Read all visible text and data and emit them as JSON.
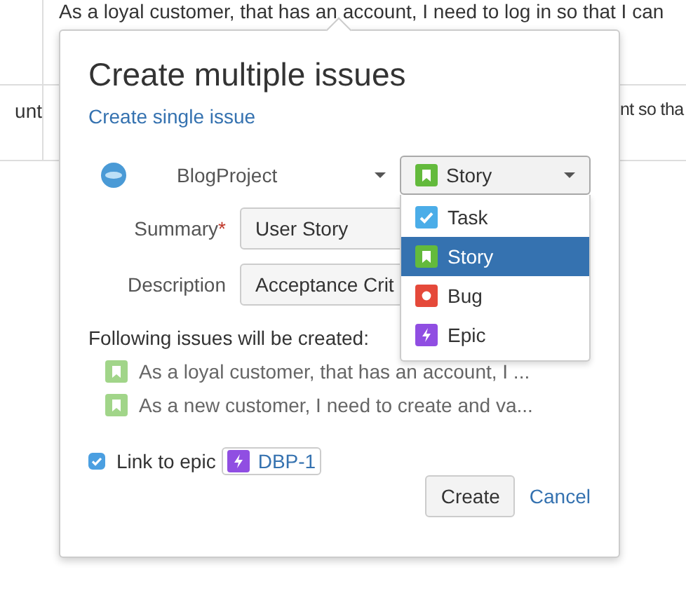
{
  "background": {
    "top_text": "As a loyal customer, that has an account, I need to log in so that I can",
    "left_text": "unt",
    "right_text": "nt so tha"
  },
  "dialog": {
    "title": "Create multiple issues",
    "single_link": "Create single issue",
    "project": {
      "name": "BlogProject"
    },
    "issue_type": {
      "value": "Story",
      "kind": "story"
    },
    "type_menu": [
      {
        "label": "Task",
        "kind": "task",
        "selected": false
      },
      {
        "label": "Story",
        "kind": "story",
        "selected": true
      },
      {
        "label": "Bug",
        "kind": "bug",
        "selected": false
      },
      {
        "label": "Epic",
        "kind": "epic",
        "selected": false
      }
    ],
    "fields": [
      {
        "label": "Summary",
        "required_mark": "*",
        "value": "User Story"
      },
      {
        "label": "Description",
        "value": "Acceptance Crit"
      }
    ],
    "issues_heading": "Following issues will be created:",
    "issues": [
      {
        "kind": "story",
        "text": "As a loyal customer, that has an account, I ..."
      },
      {
        "kind": "story",
        "text": "As a new customer, I need to create and va..."
      }
    ],
    "epic_link": {
      "checked": true,
      "label": "Link to epic",
      "kind": "epic",
      "key": "DBP-1"
    },
    "buttons": {
      "create": "Create",
      "cancel": "Cancel"
    }
  }
}
